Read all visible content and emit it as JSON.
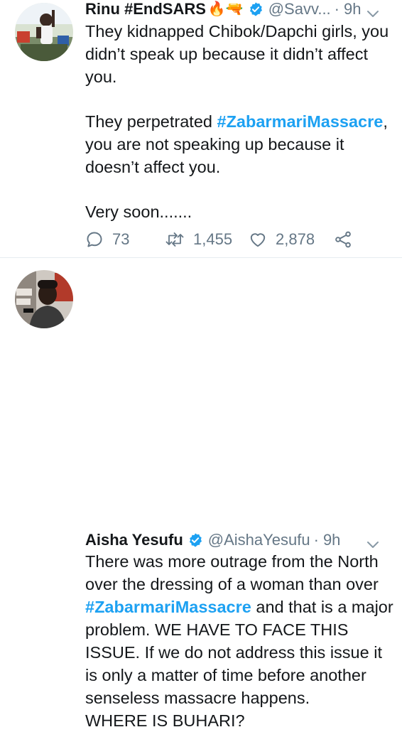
{
  "tweets": [
    {
      "author_name": "Rinu #EndSARS",
      "author_emoji": "🔥🔫",
      "handle": "@Savv...",
      "separator": "·",
      "time": "9h",
      "text": {
        "p1": "They kidnapped Chibok/Dapchi girls, you didn’t speak up because it didn’t affect you.",
        "p2_pre": "They perpetrated ",
        "p2_tag": "#ZabarmariMassacre",
        "p2_post": ", you are not speaking up because it doesn’t affect you.",
        "p3": "Very soon......."
      },
      "replies": "73",
      "retweets": "1,455",
      "likes": "2,878"
    },
    {
      "author_name": "Aisha Yesufu",
      "handle": "@AishaYesufu",
      "separator": "·",
      "time": "9h",
      "text": {
        "l1": "There was more outrage from the North over the dressing of a woman than over ",
        "tag": "#ZabarmariMassacre",
        "l2": " and that is a major problem. WE HAVE TO FACE THIS ISSUE. If we do not address this issue it is only a matter of time before another senseless massacre happens.",
        "l3": "WHERE IS BUHARI?"
      }
    }
  ],
  "colors": {
    "text": "#14171a",
    "secondary": "#657786",
    "link": "#1da1f2",
    "verified": "#1da1f2",
    "divider": "#e6ecf0"
  },
  "icons": {
    "reply": "reply-icon",
    "retweet": "retweet-icon",
    "like": "heart-icon",
    "share": "share-icon",
    "verified": "verified-badge-icon",
    "menu": "chevron-down-icon"
  }
}
